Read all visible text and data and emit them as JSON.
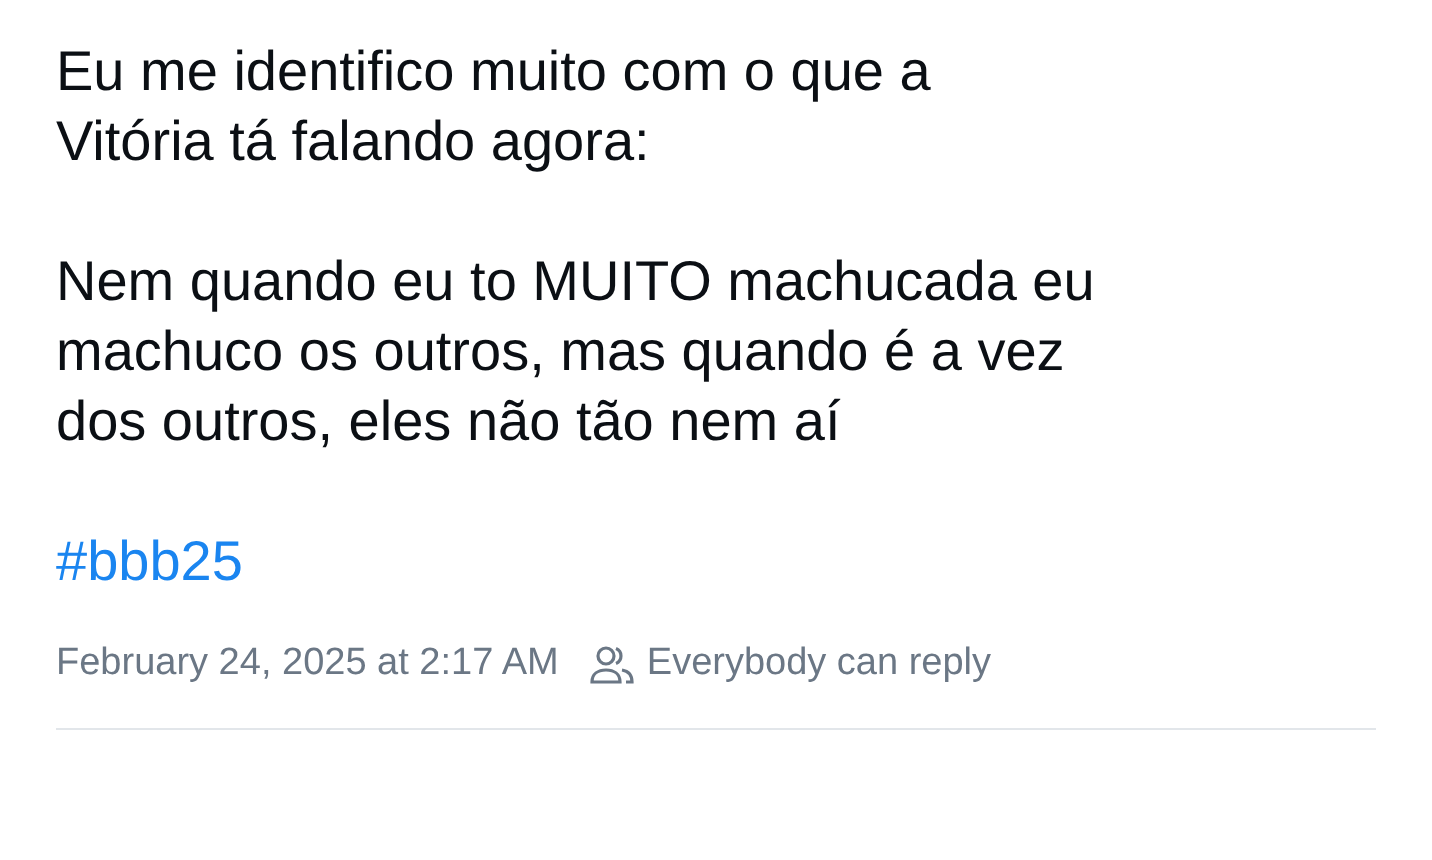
{
  "post": {
    "paragraphs": [
      "Eu me identifico muito com o que a\nVitória tá falando agora:",
      "Nem quando eu to MUITO machucada eu\nmachuco os outros, mas quando é a vez\ndos outros, eles não tão nem aí"
    ],
    "hashtag": "#bbb25",
    "timestamp": "February 24, 2025 at 2:17 AM",
    "reply_setting": "Everybody can reply"
  }
}
